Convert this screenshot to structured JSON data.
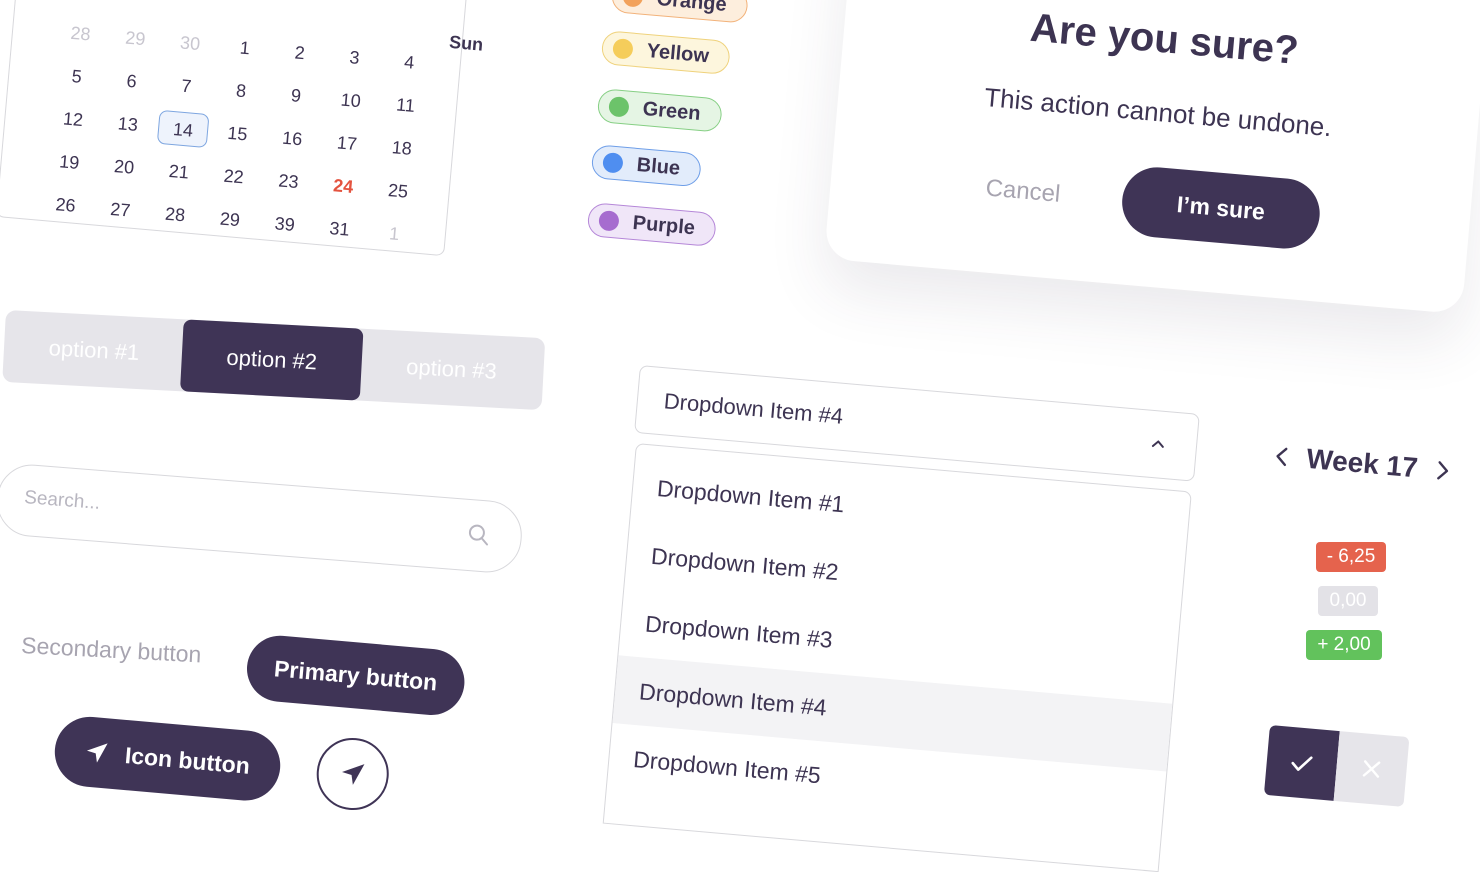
{
  "calendar": {
    "header_partial": "Sun",
    "weeks": [
      [
        "28",
        "29",
        "30",
        "1",
        "2",
        "3",
        "4"
      ],
      [
        "5",
        "6",
        "7",
        "8",
        "9",
        "10",
        "11"
      ],
      [
        "12",
        "13",
        "14",
        "15",
        "16",
        "17",
        "18"
      ],
      [
        "19",
        "20",
        "21",
        "22",
        "23",
        "24",
        "25"
      ],
      [
        "26",
        "27",
        "28",
        "29",
        "39",
        "31",
        "1"
      ]
    ],
    "selected_day": "14",
    "today": "24"
  },
  "tags": [
    {
      "label": "Orange",
      "dot": "#f2a25c",
      "bg": "#fdeedd",
      "border": "#f2b27a",
      "text": "#3d3452"
    },
    {
      "label": "Yellow",
      "dot": "#f5cd5b",
      "bg": "#fdf6dd",
      "border": "#efd27c",
      "text": "#3d3452"
    },
    {
      "label": "Green",
      "dot": "#6cc36a",
      "bg": "#e5f5e4",
      "border": "#86cf84",
      "text": "#3d3452"
    },
    {
      "label": "Blue",
      "dot": "#4f8ef0",
      "bg": "#e2ecfb",
      "border": "#6e9ee8",
      "text": "#3d3452"
    },
    {
      "label": "Purple",
      "dot": "#a66ccf",
      "bg": "#f0e6f8",
      "border": "#b587d8",
      "text": "#3d3452"
    }
  ],
  "modal": {
    "title": "Are you sure?",
    "message": "This action cannot be undone.",
    "cancel_label": "Cancel",
    "confirm_label": "I’m sure"
  },
  "segmented": {
    "options": [
      "option #1",
      "option #2",
      "option #3"
    ],
    "selected": "option #2"
  },
  "search": {
    "placeholder": "Search..."
  },
  "buttons": {
    "secondary_label": "Secondary button",
    "primary_label": "Primary button",
    "icon_button_label": "Icon button"
  },
  "dropdown": {
    "selected_value": "Dropdown Item #4",
    "items": [
      "Dropdown Item #1",
      "Dropdown Item #2",
      "Dropdown Item #3",
      "Dropdown Item #4",
      "Dropdown Item #5"
    ]
  },
  "week": {
    "label": "Week 17"
  },
  "value_badges": [
    {
      "label": "- 6,25",
      "color": "#e5634d"
    },
    {
      "label": "0,00",
      "color": "#e3e2e7"
    },
    {
      "label": "+ 2,00",
      "color": "#62c25c"
    }
  ],
  "colors": {
    "primary": "#3f3456",
    "muted": "#a7a4b0",
    "highlight": "#e4533f"
  }
}
